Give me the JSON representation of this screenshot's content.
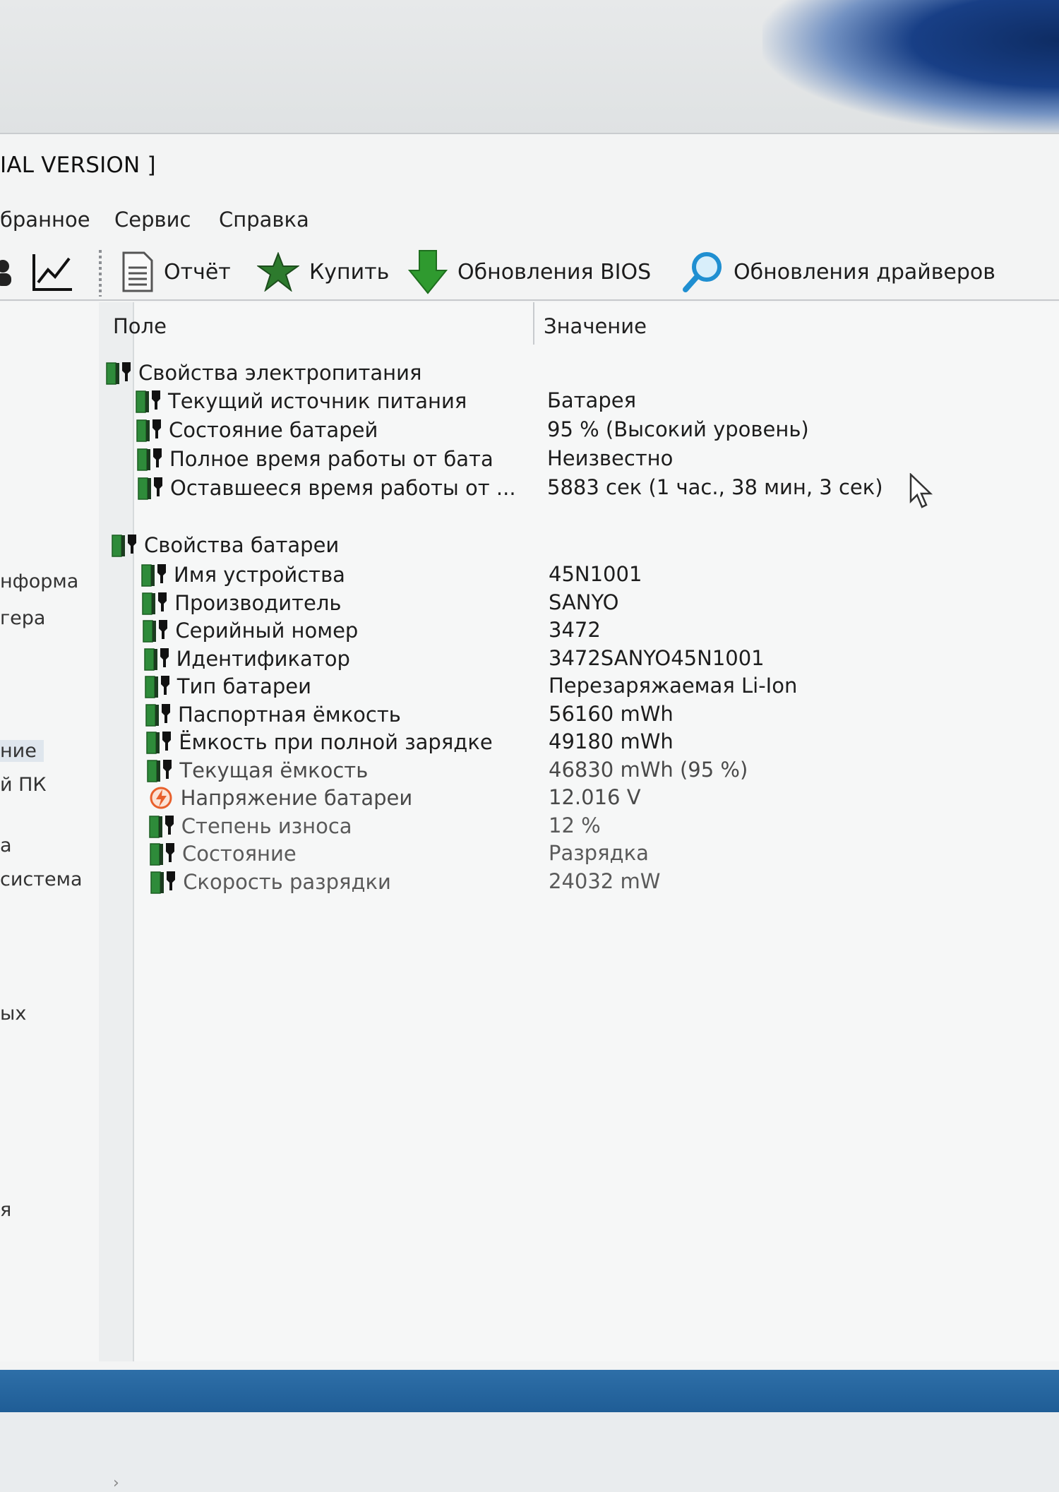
{
  "window": {
    "title": "IAL VERSION ]"
  },
  "menu": {
    "items": [
      "бранное",
      "Сервис",
      "Справка"
    ]
  },
  "toolbar": {
    "report_label": "Отчёт",
    "buy_label": "Купить",
    "bios_label": "Обновления BIOS",
    "drivers_label": "Обновления драйверов"
  },
  "tree": {
    "items": [
      "нформа",
      "гера",
      "ние",
      "й ПК",
      "а",
      "система",
      "ых",
      "я"
    ],
    "selected_index": 2
  },
  "columns": {
    "field": "Поле",
    "value": "Значение"
  },
  "groups": [
    {
      "title": "Свойства электропитания",
      "rows": [
        {
          "field": "Текущий источник питания",
          "value": "Батарея"
        },
        {
          "field": "Состояние батарей",
          "value": "95 % (Высокий уровень)"
        },
        {
          "field": "Полное время работы от бата",
          "value": "Неизвестно"
        },
        {
          "field": "Оставшееся время работы от ...",
          "value": "5883 сек (1 час., 38 мин, 3 сек)"
        }
      ]
    },
    {
      "title": "Свойства батареи",
      "rows": [
        {
          "field": "Имя устройства",
          "value": "45N1001"
        },
        {
          "field": "Производитель",
          "value": "SANYO"
        },
        {
          "field": "Серийный номер",
          "value": "3472"
        },
        {
          "field": "Идентификатор",
          "value": "3472SANYO45N1001"
        },
        {
          "field": "Тип батареи",
          "value": "Перезаряжаемая Li-Ion"
        },
        {
          "field": "Паспортная ёмкость",
          "value": "56160 mWh"
        },
        {
          "field": "Ёмкость при полной зарядке",
          "value": "49180 mWh"
        },
        {
          "field": "Текущая ёмкость",
          "value": "46830 mWh  (95 %)"
        },
        {
          "field": "Напряжение батареи",
          "value": "12.016 V",
          "icon": "voltage-icon"
        },
        {
          "field": "Степень износа",
          "value": "12 %"
        },
        {
          "field": "Состояние",
          "value": "Разрядка"
        },
        {
          "field": "Скорость разрядки",
          "value": "24032 mW"
        }
      ]
    }
  ],
  "colors": {
    "battery_green": "#2e8b3a",
    "voltage_orange": "#e8602c",
    "download_green": "#2f9a2f",
    "search_blue": "#1f8fd1"
  }
}
